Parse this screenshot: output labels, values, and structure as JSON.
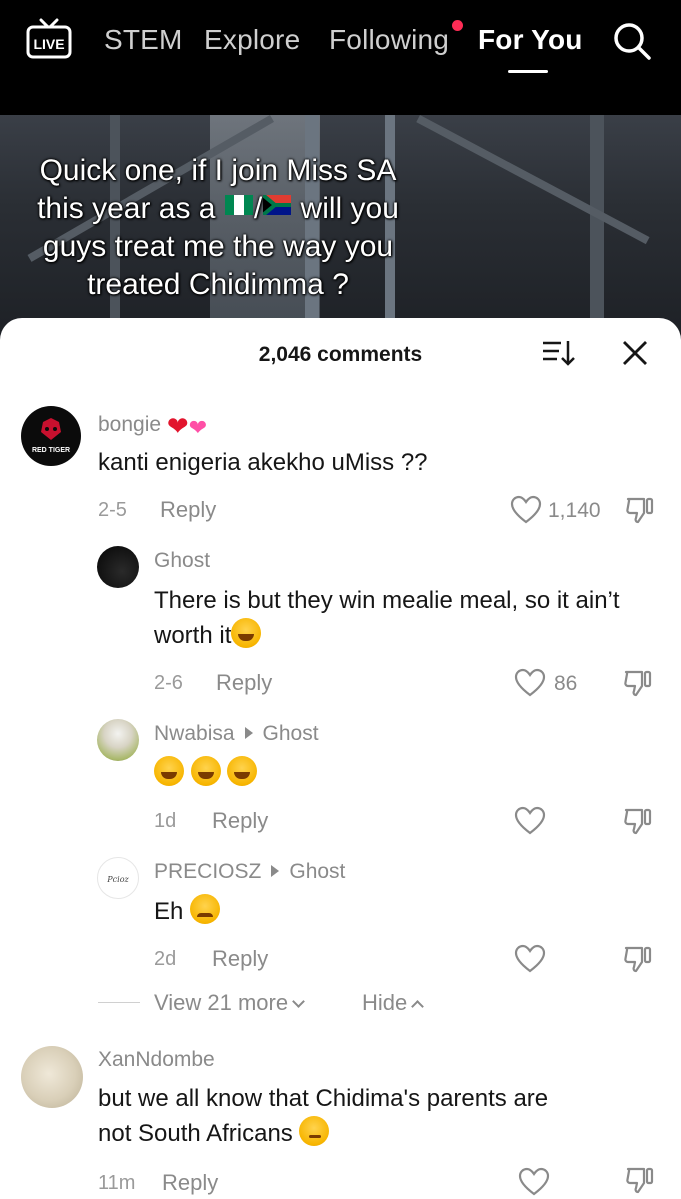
{
  "nav": {
    "live_label": "LIVE",
    "tabs": [
      "STEM",
      "Explore",
      "Following",
      "For You"
    ],
    "active_tab": "For You"
  },
  "video": {
    "caption_lines": [
      "Quick one, if I join Miss SA",
      "this year as a",
      "will you",
      "guys treat me the way you",
      "treated Chidimma ?"
    ],
    "caption_sep": "/"
  },
  "comments_header": {
    "title": "2,046 comments"
  },
  "comments": [
    {
      "username": "bongie",
      "avatar_text": "RED TIGER",
      "text": "kanti enigeria akekho uMiss ??",
      "date": "2-5",
      "reply": "Reply",
      "likes": "1,140"
    },
    {
      "username": "Ghost",
      "text": "There is but they win mealie meal, so it ain’t worth it",
      "date": "2-6",
      "reply": "Reply",
      "likes": "86"
    },
    {
      "username": "Nwabisa",
      "reply_to": "Ghost",
      "text": "",
      "date": "1d",
      "reply": "Reply"
    },
    {
      "username": "PRECIOSZ",
      "avatar_text": "Pcioz",
      "reply_to": "Ghost",
      "text": "Eh",
      "date": "2d",
      "reply": "Reply"
    },
    {
      "username": "XanNdombe",
      "text_lines": [
        "but we all know that Chidima's parents are",
        "not South Africans"
      ],
      "date": "11m",
      "reply": "Reply"
    }
  ],
  "thread": {
    "view_more": "View 21 more",
    "hide": "Hide"
  }
}
